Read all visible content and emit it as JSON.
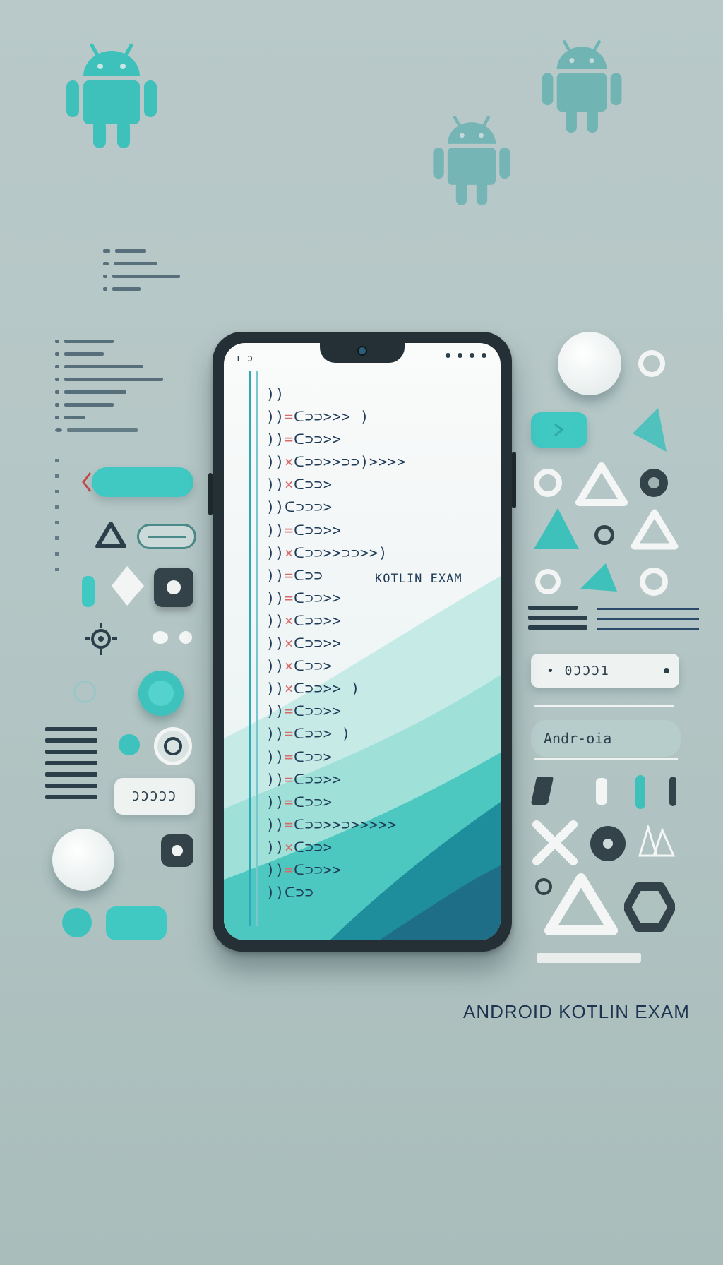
{
  "title": "ANDROID KOTLIN EXAM",
  "screen_label": "KOTLIN EXAM",
  "right_chip_label": "Andr-oia",
  "right_pill_text": "• 0ƆƆƆ1",
  "left_pill_text": "ƆƆƆƆƆ",
  "code_lines": [
    {
      "prefix": "))",
      "red": "",
      "body": ""
    },
    {
      "prefix": "))",
      "red": "=",
      "body": "ᑕ⊃⊃>>>    )"
    },
    {
      "prefix": "))",
      "red": "=",
      "body": "ᑕ⊃⊃>>"
    },
    {
      "prefix": "))",
      "red": "×",
      "body": "ᑕ⊃⊃>>⊃⊃)>>>>"
    },
    {
      "prefix": "))",
      "red": "×",
      "body": "ᑕ⊃⊃>"
    },
    {
      "prefix": "))",
      "red": "",
      "body": "ᑕ⊃⊃⊃>"
    },
    {
      "prefix": "))",
      "red": "=",
      "body": "ᑕ⊃⊃>>"
    },
    {
      "prefix": "))",
      "red": "×",
      "body": "ᑕ⊃⊃>>⊃⊃>>)"
    },
    {
      "prefix": "))",
      "red": "=",
      "body": "ᑕ⊃⊃"
    },
    {
      "prefix": "))",
      "red": "=",
      "body": "ᑕ⊃⊃>>"
    },
    {
      "prefix": "))",
      "red": "×",
      "body": "ᑕ⊃⊃>>"
    },
    {
      "prefix": "))",
      "red": "×",
      "body": "ᑕ⊃⊃>>"
    },
    {
      "prefix": "))",
      "red": "×",
      "body": "ᑕ⊃⊃>"
    },
    {
      "prefix": "))",
      "red": "×",
      "body": "ᑕ⊃⊃>>    )"
    },
    {
      "prefix": "))",
      "red": "=",
      "body": "ᑕ⊃⊃>>"
    },
    {
      "prefix": "))",
      "red": "=",
      "body": "ᑕ⊃⊃>     )"
    },
    {
      "prefix": "))",
      "red": "=",
      "body": "ᑕ⊃⊃>"
    },
    {
      "prefix": "))",
      "red": "=",
      "body": "ᑕ⊃⊃>>"
    },
    {
      "prefix": "))",
      "red": "=",
      "body": "ᑕ⊃⊃>"
    },
    {
      "prefix": "))",
      "red": "=",
      "body": "ᑕ⊃⊃>>⊃>>>>>"
    },
    {
      "prefix": "))",
      "red": "×",
      "body": "ᑕ⊃⊃>"
    },
    {
      "prefix": "))",
      "red": "=",
      "body": "ᑕ⊃⊃>>"
    },
    {
      "prefix": "))",
      "red": "",
      "body": "ᑕ⊃⊃"
    }
  ],
  "colors": {
    "background": "#b6c8c7",
    "teal": "#40c9c3",
    "navy": "#1d3450",
    "phone": "#243036"
  },
  "icons": [
    "android-robot-icon",
    "gear-icon",
    "triangle-icon",
    "x-icon",
    "hexagon-icon"
  ]
}
